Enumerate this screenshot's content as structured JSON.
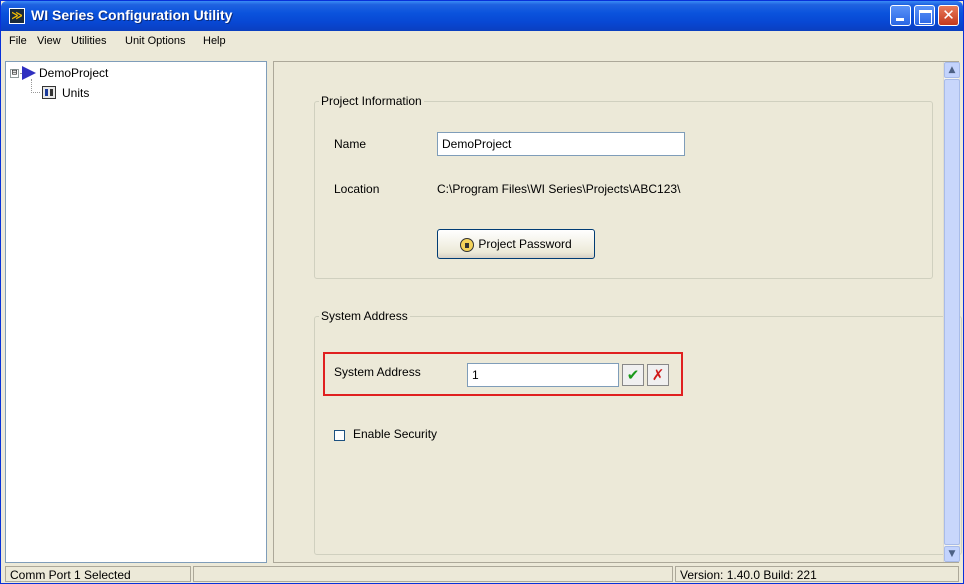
{
  "window": {
    "title": "WI Series Configuration Utility"
  },
  "menu": {
    "items": [
      {
        "label": "File"
      },
      {
        "label": "View"
      },
      {
        "label": "Utilities"
      },
      {
        "label": "Unit Options"
      },
      {
        "label": "Help"
      }
    ]
  },
  "tree": {
    "root": {
      "label": "DemoProject",
      "expander": "⊟"
    },
    "children": [
      {
        "label": "Units"
      }
    ]
  },
  "project_info": {
    "legend": "Project Information",
    "name_label": "Name",
    "name_value": "DemoProject",
    "location_label": "Location",
    "location_value": "C:\\Program Files\\WI Series\\Projects\\ABC123\\",
    "password_button": "Project Password"
  },
  "system_address": {
    "legend": "System Address",
    "field_label": "System Address",
    "field_value": "1",
    "confirm_glyph": "✔",
    "cancel_glyph": "✗",
    "enable_security_label": "Enable Security",
    "enable_security_checked": false
  },
  "statusbar": {
    "left": "Comm Port 1 Selected",
    "middle": "",
    "right": "Version: 1.40.0 Build: 221"
  },
  "colors": {
    "highlight": "#e02020",
    "titlebar": "#0a53dd",
    "confirm": "#1a9a1a",
    "cancel": "#d01818"
  }
}
